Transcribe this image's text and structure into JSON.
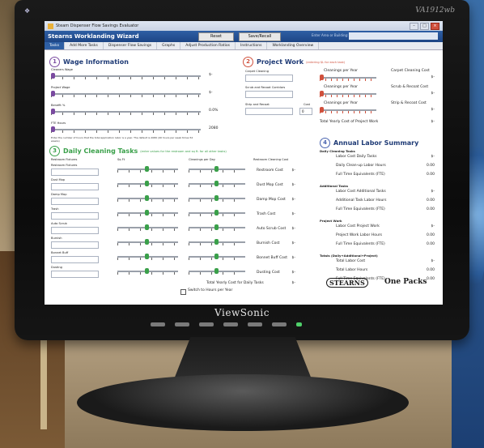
{
  "monitor": {
    "brand": "ViewSonic",
    "model": "VA1912wb"
  },
  "window": {
    "title": "Steam Dispenser Flow Savings Evaluator"
  },
  "app": {
    "title": "Stearns Worklanding Wizard",
    "buttons": {
      "reset": "Reset",
      "save_recall": "Save/Recall"
    },
    "field_label": "Enter Area or Building:",
    "field_value": ""
  },
  "tabs": [
    "Tasks",
    "Add More Tasks",
    "Dispenser Flow Savings",
    "Graphs",
    "Adjust Production Ratios",
    "Instructions",
    "Worklanding Overview"
  ],
  "wage": {
    "title": "Wage Information",
    "rows": [
      {
        "label": "Cleaners Wage",
        "value": "$-"
      },
      {
        "label": "Project Wage",
        "value": "$-"
      },
      {
        "label": "Benefit %",
        "value": "0.0%"
      },
      {
        "label": "FTE Hours",
        "value": "2080"
      }
    ],
    "note": "Enter the number of hours that the total application labor is a year. The default is 2080 (40 hours per week times 52 weeks)"
  },
  "project_work": {
    "title": "Project Work",
    "hint": "(entering $L for each task)",
    "task_label_1": "Carpet Cleaning",
    "task_label_2": "Scrub and Recoat Corridors",
    "task_label_3": "Strip and Recoat",
    "cost_label": "Cost",
    "cost_value": "0",
    "cleanings": [
      "Cleanings per Year",
      "Cleanings per Year",
      "Cleanings per Year"
    ],
    "costs": [
      {
        "label": "Carpet Cleaning Cost",
        "value": "$-"
      },
      {
        "label": "Scrub & Recoat Cost",
        "value": "$-"
      },
      {
        "label": "Strip & Recoat Cost",
        "value": "$-"
      }
    ],
    "total_label": "Total Yearly Cost of Project Work",
    "total_value": "$-"
  },
  "daily": {
    "title": "Daily Cleaning Tasks",
    "hint": "(enter values for the restroom and sq ft. for all other tasks)",
    "col_headers": [
      "Restroom Fixtures",
      "Sq Ft",
      "Cleanings per Day",
      "Restroom Cleaning Cost"
    ],
    "tasks": [
      {
        "label": "Restroom Fixtures",
        "cost_label": "Restroom Cost"
      },
      {
        "label": "Dust Mop",
        "cost_label": "Dust Mop Cost"
      },
      {
        "label": "Damp Mop",
        "cost_label": "Damp Mop Cost"
      },
      {
        "label": "Trash",
        "cost_label": "Trash Cost"
      },
      {
        "label": "Auto Scrub",
        "cost_label": "Auto Scrub Cost"
      },
      {
        "label": "Burnish",
        "cost_label": "Burnish Cost"
      },
      {
        "label": "Bonnet Buff",
        "cost_label": "Bonnet Buff Cost"
      },
      {
        "label": "Dusting",
        "cost_label": "Dusting Cost"
      }
    ],
    "cost_values": [
      "$-",
      "$-",
      "$-",
      "$-",
      "$-",
      "$-",
      "$-",
      "$-",
      "$-"
    ],
    "total_label": "Total Yearly Cost for Daily Tasks",
    "total_value": "$-",
    "switch_label": "Switch to Hours per Year"
  },
  "annual": {
    "title": "Annual Labor Summary",
    "groups": [
      {
        "head": "Daily Cleaning Tasks",
        "rows": [
          {
            "label": "Labor Cost Daily Tasks",
            "value": "$-"
          },
          {
            "label": "Daily Clean-up Labor Hours",
            "value": "0.00"
          },
          {
            "label": "Full Time Equivalents (FTE)",
            "value": "0.00"
          }
        ]
      },
      {
        "head": "Additional Tasks",
        "rows": [
          {
            "label": "Labor Cost Additional Tasks",
            "value": "$-"
          },
          {
            "label": "Additional Task Labor Hours",
            "value": "0.00"
          },
          {
            "label": "Full Time Equivalents (FTE)",
            "value": "0.00"
          }
        ]
      },
      {
        "head": "Project Work",
        "rows": [
          {
            "label": "Labor Cost Project Work",
            "value": "$-"
          },
          {
            "label": "Project Work Labor Hours",
            "value": "0.00"
          },
          {
            "label": "Full Time Equivalents (FTE)",
            "value": "0.00"
          }
        ]
      },
      {
        "head": "Totals (Daily+Additional+Project)",
        "rows": [
          {
            "label": "Total Labor Cost",
            "value": "$-"
          },
          {
            "label": "Total Labor Hours",
            "value": "0.00"
          },
          {
            "label": "Full Time Equivalents (FTE)",
            "value": "0.00"
          }
        ]
      }
    ],
    "logos": {
      "left": "STEARNS",
      "right": "One Packs"
    }
  }
}
